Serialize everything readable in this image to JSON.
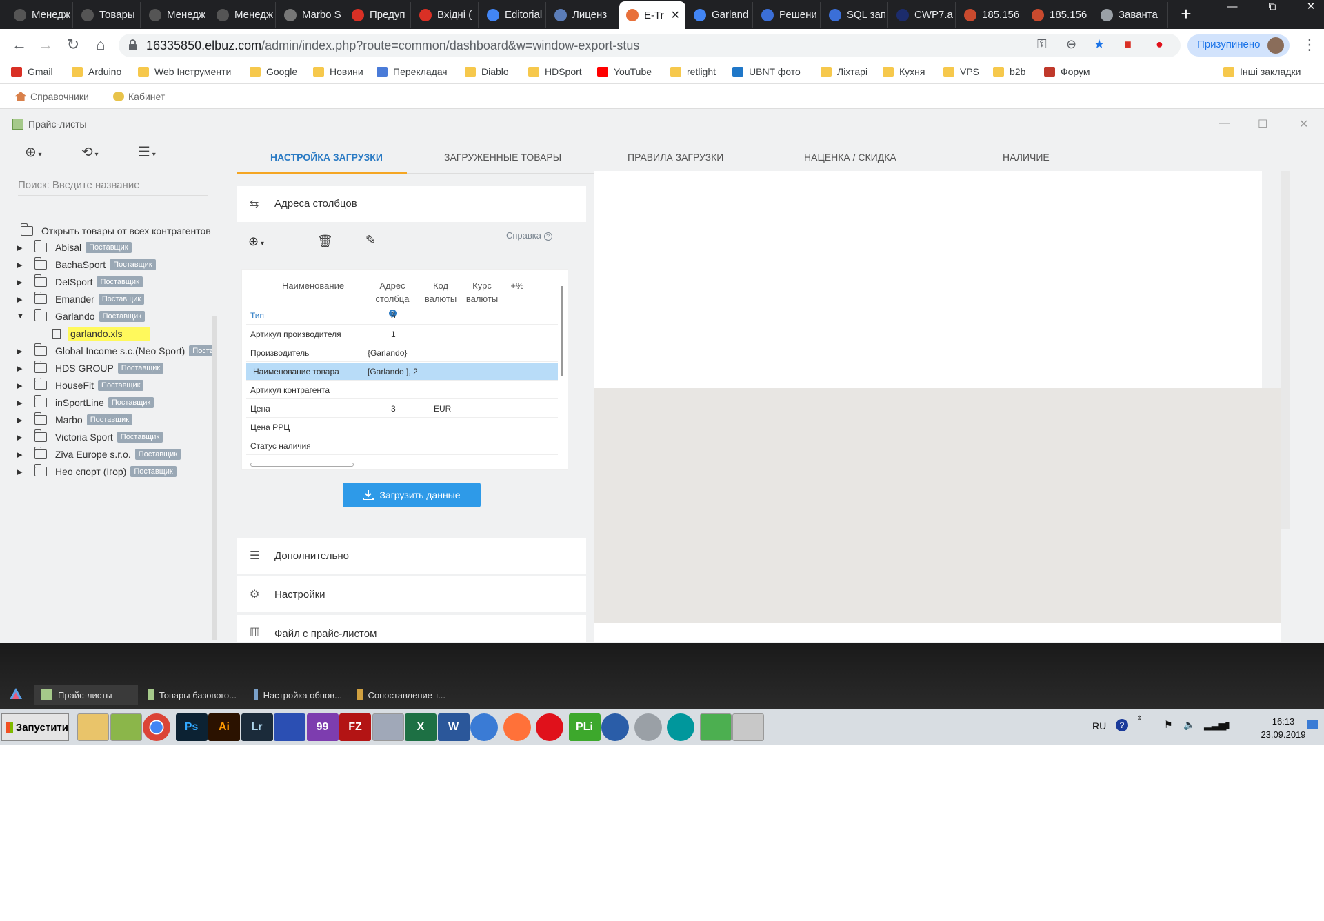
{
  "browser": {
    "tabs": [
      {
        "label": "Менедж",
        "icon": "elbuz-icon",
        "color": "#555"
      },
      {
        "label": "Товары",
        "icon": "elbuz-icon",
        "color": "#555"
      },
      {
        "label": "Менедж",
        "icon": "elbuz-icon",
        "color": "#555"
      },
      {
        "label": "Менедж",
        "icon": "elbuz-icon",
        "color": "#555"
      },
      {
        "label": "Marbo S",
        "icon": "cart-icon",
        "color": "#777"
      },
      {
        "label": "Предуп",
        "icon": "gmail-icon",
        "color": "#d93025"
      },
      {
        "label": "Вхідні (",
        "icon": "gmail-icon",
        "color": "#d93025"
      },
      {
        "label": "Editorial",
        "icon": "google-icon",
        "color": "#4285f4"
      },
      {
        "label": "Лиценз",
        "icon": "globe-icon",
        "color": "#5b7db8"
      },
      {
        "label": "E-Tr",
        "icon": "fox-icon",
        "color": "#e8703a"
      },
      {
        "label": "Garland",
        "icon": "google-icon",
        "color": "#4285f4"
      },
      {
        "label": "Решени",
        "icon": "triangle-icon",
        "color": "#3b6fd8"
      },
      {
        "label": "SQL зап",
        "icon": "triangle-icon",
        "color": "#3b6fd8"
      },
      {
        "label": "CWP7.a",
        "icon": "cwp-icon",
        "color": "#1c2c6c"
      },
      {
        "label": "185.156",
        "icon": "mikrotik-icon",
        "color": "#c94a2e"
      },
      {
        "label": "185.156",
        "icon": "mikrotik-icon",
        "color": "#c94a2e"
      },
      {
        "label": "Заванта",
        "icon": "download-icon",
        "color": "#9aa0a6"
      }
    ],
    "active_tab_close": "✕",
    "new_tab": "+",
    "window_controls": [
      "—",
      "⧉",
      "✕"
    ],
    "url_host": "16335850.elbuz.com",
    "url_rest": "/admin/index.php?route=common/dashboard&w=window-export-stus",
    "profile_label": "Призупинено",
    "bookmarks": [
      {
        "label": "Gmail",
        "icon": "gmail-icon",
        "color": "#d93025"
      },
      {
        "label": "Arduino",
        "icon": "folder-icon",
        "color": "#f6c84c"
      },
      {
        "label": "Web Інструменти",
        "icon": "folder-icon",
        "color": "#f6c84c"
      },
      {
        "label": "Google",
        "icon": "folder-icon",
        "color": "#f6c84c"
      },
      {
        "label": "Новини",
        "icon": "folder-icon",
        "color": "#f6c84c"
      },
      {
        "label": "Перекладач",
        "icon": "translate-icon",
        "color": "#4a7bd8"
      },
      {
        "label": "Diablo",
        "icon": "folder-icon",
        "color": "#f6c84c"
      },
      {
        "label": "HDSport",
        "icon": "folder-icon",
        "color": "#f6c84c"
      },
      {
        "label": "YouTube",
        "icon": "youtube-icon",
        "color": "#ff0000"
      },
      {
        "label": "retlight",
        "icon": "folder-icon",
        "color": "#f6c84c"
      },
      {
        "label": "UBNT фото",
        "icon": "ubnt-icon",
        "color": "#1f77c8"
      },
      {
        "label": "Ліхтарі",
        "icon": "folder-icon",
        "color": "#f6c84c"
      },
      {
        "label": "Кухня",
        "icon": "folder-icon",
        "color": "#f6c84c"
      },
      {
        "label": "VPS",
        "icon": "folder-icon",
        "color": "#f6c84c"
      },
      {
        "label": "b2b",
        "icon": "folder-icon",
        "color": "#f6c84c"
      },
      {
        "label": "Форум",
        "icon": "forum-icon",
        "color": "#c0392b"
      }
    ],
    "other_bookmarks": "Інші закладки"
  },
  "app_toolbar": {
    "items": [
      "Справочники",
      "Кабинет"
    ]
  },
  "window": {
    "title": "Прайс-листы",
    "search_placeholder": "Поиск: Введите название",
    "tree_root": "Открыть товары от всех контрагентов",
    "tree": [
      {
        "label": "Abisal",
        "badge": "Поставщик"
      },
      {
        "label": "BachaSport",
        "badge": "Поставщик"
      },
      {
        "label": "DelSport",
        "badge": "Поставщик"
      },
      {
        "label": "Emander",
        "badge": "Поставщик"
      },
      {
        "label": "Garlando",
        "badge": "Поставщик"
      },
      {
        "label": "Global Income s.c.(Neo Sport)",
        "badge": "Поставщик"
      },
      {
        "label": "HDS GROUP",
        "badge": "Поставщик"
      },
      {
        "label": "HouseFit",
        "badge": "Поставщик"
      },
      {
        "label": "inSportLine",
        "badge": "Поставщик"
      },
      {
        "label": "Marbo",
        "badge": "Поставщик"
      },
      {
        "label": "Victoria Sport",
        "badge": "Поставщик"
      },
      {
        "label": "Ziva Europe s.r.o.",
        "badge": "Поставщик"
      },
      {
        "label": "Нео спорт (Ігор)",
        "badge": "Поставщик"
      }
    ],
    "tree_file": "garlando.xls",
    "tabs": [
      "НАСТРОЙКА ЗАГРУЗКИ",
      "ЗАГРУЖЕННЫЕ ТОВАРЫ",
      "ПРАВИЛА ЗАГРУЗКИ",
      "НАЦЕНКА / СКИДКА",
      "НАЛИЧИЕ"
    ],
    "panel_title": "Адреса столбцов",
    "help": "Справка",
    "grid": {
      "headers": [
        "Наименование",
        "Адрес столбца",
        "Код валюты",
        "Курс валюты",
        "+%"
      ],
      "rows": [
        {
          "name": "Тип",
          "addr": "5",
          "code": "",
          "rate": ""
        },
        {
          "name": "Артикул производителя",
          "addr": "1",
          "code": "",
          "rate": ""
        },
        {
          "name": "Производитель",
          "addr": "{Garlando}",
          "code": "",
          "rate": ""
        },
        {
          "name": "Наименование товара",
          "addr": "[Garlando ], 2",
          "code": "",
          "rate": ""
        },
        {
          "name": "Артикул контрагента",
          "addr": "",
          "code": "",
          "rate": ""
        },
        {
          "name": "Цена",
          "addr": "3",
          "code": "EUR",
          "rate": ""
        },
        {
          "name": "Цена РРЦ",
          "addr": "",
          "code": "",
          "rate": ""
        },
        {
          "name": "Статус наличия",
          "addr": "",
          "code": "",
          "rate": ""
        }
      ]
    },
    "load_button": "Загрузить данные",
    "sections": [
      "Дополнительно",
      "Настройки",
      "Файл с прайс-листом"
    ]
  },
  "taskbar": {
    "windows": [
      "Прайс-листы",
      "Товары базового...",
      "Настройка обнов...",
      "Сопоставление т..."
    ],
    "start": "Запустити",
    "apps": [
      {
        "icon": "explorer-icon",
        "label": "",
        "color": "#e9c46a"
      },
      {
        "icon": "notepad-icon",
        "label": "",
        "color": "#8bb64a"
      },
      {
        "icon": "chrome-icon",
        "label": "",
        "color": "#ffffff"
      },
      {
        "icon": "photoshop-icon",
        "label": "Ps",
        "color": "#0c2233"
      },
      {
        "icon": "illustrator-icon",
        "label": "Ai",
        "color": "#2b1200"
      },
      {
        "icon": "lightroom-icon",
        "label": "Lr",
        "color": "#1b2b3a"
      },
      {
        "icon": "save-icon",
        "label": "",
        "color": "#2b4fb3"
      },
      {
        "icon": "viber-icon",
        "label": "99",
        "color": "#7d3daf"
      },
      {
        "icon": "filezilla-icon",
        "label": "FZ",
        "color": "#b31414"
      },
      {
        "icon": "network-icon",
        "label": "",
        "color": "#a0a8b8"
      },
      {
        "icon": "excel-icon",
        "label": "X",
        "color": "#1d7044"
      },
      {
        "icon": "word-icon",
        "label": "W",
        "color": "#2b579a"
      },
      {
        "icon": "thunderbird-icon",
        "label": "",
        "color": "#3a7bd5"
      },
      {
        "icon": "firefox-icon",
        "label": "",
        "color": "#ff7139"
      },
      {
        "icon": "opera-icon",
        "label": "",
        "color": "#e0111b"
      },
      {
        "icon": "pli-icon",
        "label": "PLi",
        "color": "#3da82c"
      },
      {
        "icon": "moon-icon",
        "label": "",
        "color": "#2a5da8"
      },
      {
        "icon": "globe-icon",
        "label": "",
        "color": "#9aa0a6"
      },
      {
        "icon": "arduino-icon",
        "label": "",
        "color": "#00979c"
      },
      {
        "icon": "calc-icon",
        "label": "",
        "color": "#4caf50"
      },
      {
        "icon": "paint-icon",
        "label": "",
        "color": "#c8c8c8"
      }
    ],
    "lang": "RU",
    "time": "16:13",
    "date": "23.09.2019"
  }
}
